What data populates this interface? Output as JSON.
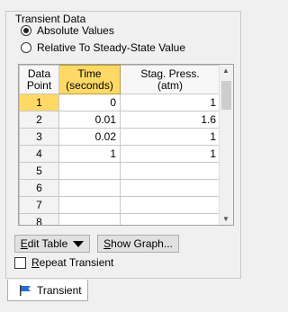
{
  "group": {
    "title": "Transient Data",
    "options": [
      {
        "label": "Absolute Values",
        "checked": true
      },
      {
        "label": "Relative To Steady-State Value",
        "checked": false
      }
    ]
  },
  "table": {
    "headers": [
      "Data\nPoint",
      "Time\n(seconds)",
      "Stag. Press.\n(atm)"
    ],
    "rows": [
      {
        "point": "1",
        "time": "0",
        "press": "1"
      },
      {
        "point": "2",
        "time": "0.01",
        "press": "1.6"
      },
      {
        "point": "3",
        "time": "0.02",
        "press": "1"
      },
      {
        "point": "4",
        "time": "1",
        "press": "1"
      },
      {
        "point": "5",
        "time": "",
        "press": ""
      },
      {
        "point": "6",
        "time": "",
        "press": ""
      },
      {
        "point": "7",
        "time": "",
        "press": ""
      },
      {
        "point": "8",
        "time": "",
        "press": ""
      }
    ]
  },
  "buttons": {
    "edit_table_prefix": "E",
    "edit_table_rest": "dit Table",
    "show_graph_prefix": "S",
    "show_graph_rest": "how Graph..."
  },
  "repeat": {
    "label_prefix": "R",
    "label_rest": "epeat Transient",
    "checked": false
  },
  "tab": {
    "label": "Transient"
  },
  "colors": {
    "highlight": "#ffd966",
    "flag": "#2a6fd0"
  }
}
